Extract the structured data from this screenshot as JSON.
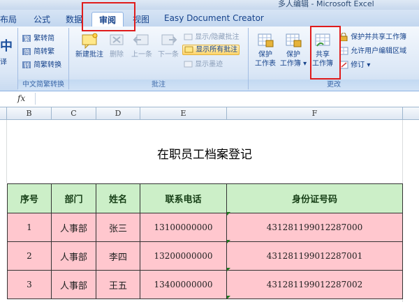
{
  "titlebar": {
    "text": "多人编辑 - Microsoft Excel"
  },
  "tabs": [
    {
      "label": "布局",
      "active": false
    },
    {
      "label": "公式",
      "active": false
    },
    {
      "label": "数据",
      "active": false
    },
    {
      "label": "审阅",
      "active": true
    },
    {
      "label": "视图",
      "active": false
    },
    {
      "label": "Easy Document Creator",
      "active": false
    }
  ],
  "ribbon": {
    "proofing_partial": {
      "big_char": "中",
      "small_label": "译"
    },
    "chinese": {
      "label": "中文简繁转换",
      "items": [
        "繁转简",
        "简转繁",
        "简繁转换"
      ]
    },
    "comments": {
      "label": "批注",
      "new": "新建批注",
      "delete": "删除",
      "prev": "上一条",
      "next": "下一条",
      "show_hide": "显示/隐藏批注",
      "show_all": "显示所有批注",
      "show_ink": "显示墨迹"
    },
    "changes": {
      "label": "更改",
      "protect_sheet": [
        "保护",
        "工作表"
      ],
      "protect_book": [
        "保护",
        "工作簿"
      ],
      "share_book": [
        "共享",
        "工作簿"
      ],
      "protect_share": "保护并共享工作簿",
      "allow_edit": "允许用户编辑区域",
      "track": "修订"
    }
  },
  "formula": {
    "fx": "fx",
    "value": ""
  },
  "columns": [
    "B",
    "C",
    "D",
    "E",
    "F"
  ],
  "sheet": {
    "title": "在职员工档案登记",
    "headers": [
      "序号",
      "部门",
      "姓名",
      "联系电话",
      "身份证号码"
    ],
    "rows": [
      [
        "1",
        "人事部",
        "张三",
        "13100000000",
        "431281199012287000"
      ],
      [
        "2",
        "人事部",
        "李四",
        "13200000000",
        "431281199012287001"
      ],
      [
        "3",
        "人事部",
        "王五",
        "13400000000",
        "431281199012287002"
      ]
    ]
  }
}
